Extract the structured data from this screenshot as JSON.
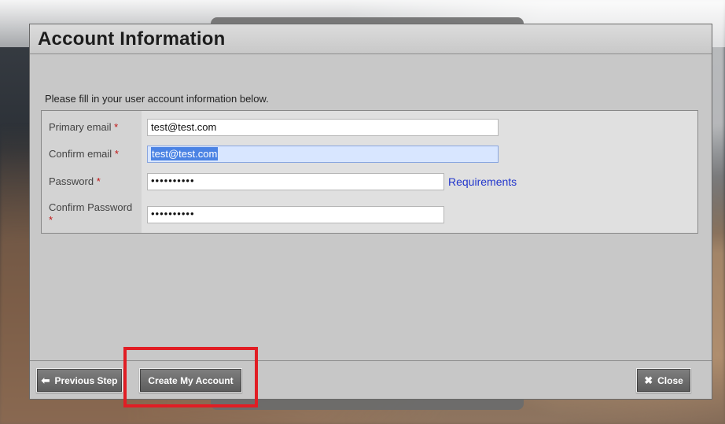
{
  "dialog": {
    "title": "Account Information",
    "intro": "Please fill in your user account information below."
  },
  "form": {
    "primary_email_label": "Primary email",
    "primary_email_value": "test@test.com",
    "confirm_email_label": "Confirm email",
    "confirm_email_value": "test@test.com",
    "password_label": "Password",
    "password_value": "••••••••••",
    "password_requirements_link": "Requirements",
    "confirm_password_label": "Confirm Password",
    "confirm_password_value": "••••••••••",
    "required_marker": "*"
  },
  "footer": {
    "previous_step_label": "Previous Step",
    "create_account_label": "Create My Account",
    "close_label": "Close"
  },
  "icons": {
    "previous_step": "arrow-left-icon",
    "close": "close-icon"
  },
  "colors": {
    "required": "#c01414",
    "link": "#2236cc",
    "highlight": "#e11d24",
    "selection": "#4b83e4"
  }
}
